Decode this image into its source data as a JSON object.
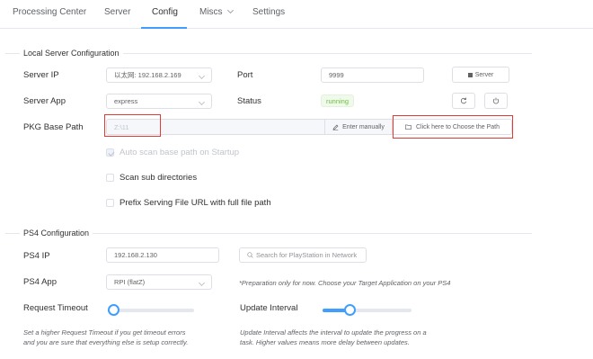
{
  "tabs": [
    {
      "label": "Processing Center"
    },
    {
      "label": "Server"
    },
    {
      "label": "Config",
      "active": true
    },
    {
      "label": "Miscs"
    },
    {
      "label": "Settings"
    }
  ],
  "local_server": {
    "title": "Local Server Configuration",
    "server_ip": {
      "label": "Server IP",
      "value": "以太网: 192.168.2.169"
    },
    "port": {
      "label": "Port",
      "value": "9999"
    },
    "server_button": "Server",
    "server_app": {
      "label": "Server App",
      "value": "express"
    },
    "status": {
      "label": "Status",
      "value": "running"
    },
    "pkg_base_path": {
      "label": "PKG Base Path",
      "value": "Z:\\11"
    },
    "enter_manually": "Enter manually",
    "choose_path": "Click here to Choose the Path",
    "auto_scan": "Auto scan base path on Startup",
    "scan_subdirs": "Scan sub directories",
    "prefix_url": "Prefix Serving File URL with full file path"
  },
  "ps4": {
    "title": "PS4 Configuration",
    "ps4_ip": {
      "label": "PS4 IP",
      "value": "192.168.2.130"
    },
    "search_placeholder": "Search for PlayStation in Network",
    "ps4_app": {
      "label": "PS4 App",
      "value": "RPI (flatZ)"
    },
    "app_note": "*Preparation only for now. Choose your Target Application on your PS4",
    "request_timeout": {
      "label": "Request Timeout",
      "level": 0.06
    },
    "update_interval": {
      "label": "Update Interval",
      "level": 0.3
    },
    "timeout_hint_1": "Set a higher Request Timeout if you get timeout errors",
    "timeout_hint_2": "and you are sure that everything else is setup correctly.",
    "interval_hint_1": "Update Interval affects the interval to update the progress on a",
    "interval_hint_2": "task. Higher values means more delay between updates."
  },
  "colors": {
    "accent": "#409eff",
    "success": "#67c23a",
    "highlight": "#e53935"
  }
}
